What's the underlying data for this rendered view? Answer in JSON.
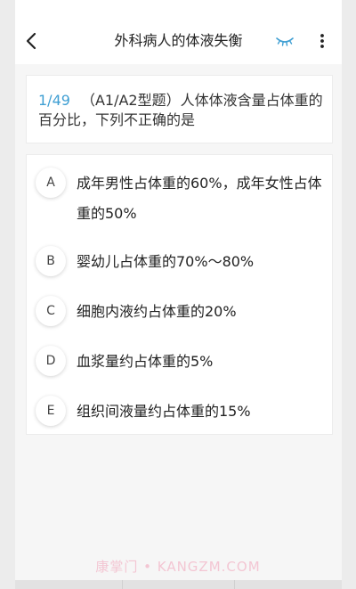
{
  "header": {
    "title": "外科病人的体液失衡",
    "back_icon": "chevron-left-icon",
    "eye_icon": "closed-eye-icon",
    "more_icon": "more-vertical-icon"
  },
  "question": {
    "index": "1/49",
    "text": "（A1/A2型题）人体体液含量占体重的百分比，下列不正确的是"
  },
  "options": [
    {
      "letter": "A",
      "text": "成年男性占体重的60%，成年女性占体重的50%"
    },
    {
      "letter": "B",
      "text": "婴幼儿占体重的70%～80%"
    },
    {
      "letter": "C",
      "text": "细胞内液约占体重的20%"
    },
    {
      "letter": "D",
      "text": "血浆量约占体重的5%"
    },
    {
      "letter": "E",
      "text": "组织间液量约占体重的15%"
    }
  ],
  "watermark": "康掌门 • KANGZM.COM",
  "colors": {
    "accent": "#3f9fd3",
    "eye_icon": "#3f9fd3",
    "watermark": "#f3c6d3"
  }
}
